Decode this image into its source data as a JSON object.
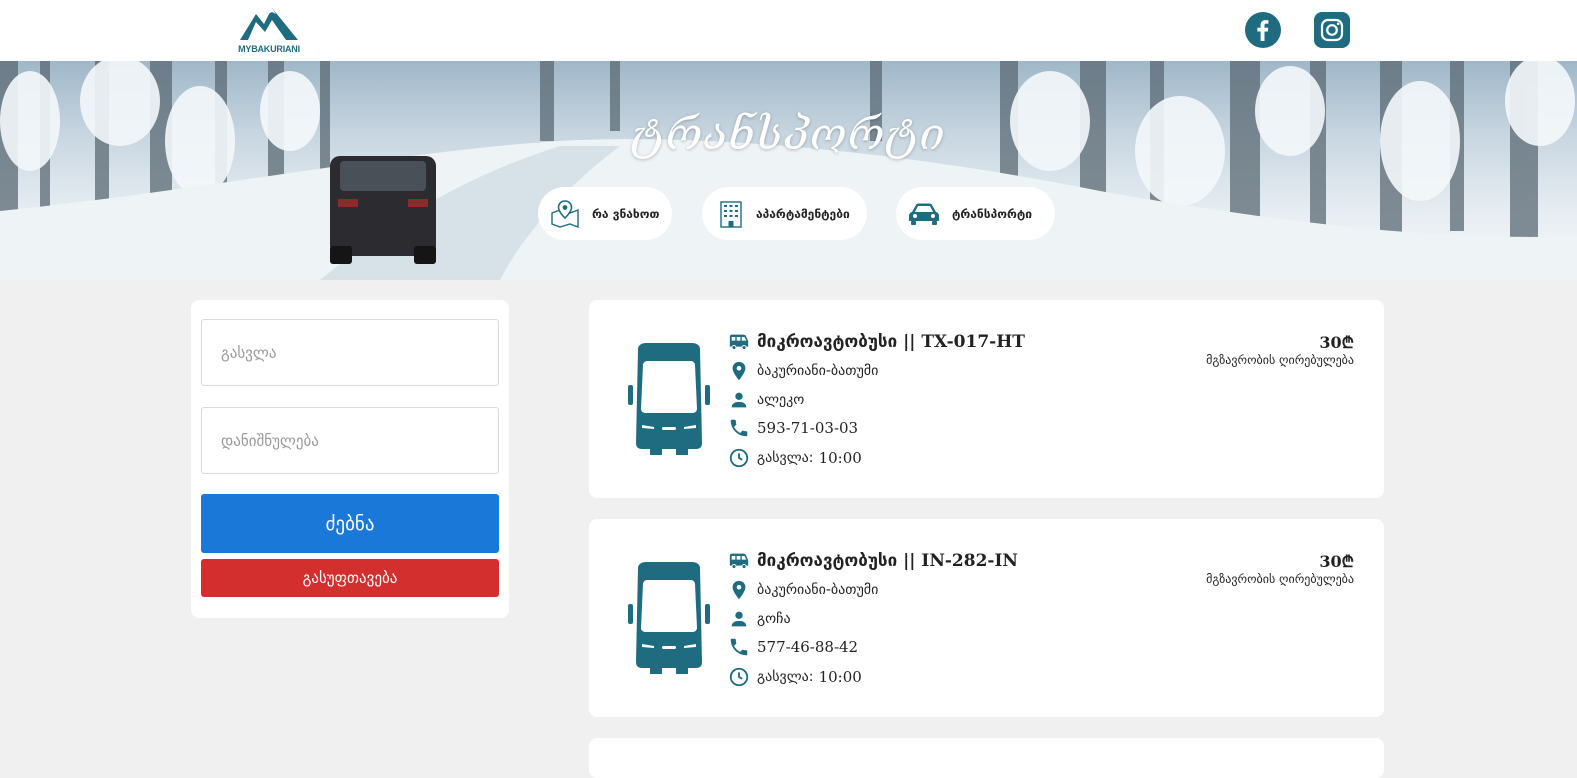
{
  "header": {
    "logo_text": "MYBAKURIANI",
    "social": [
      {
        "name": "facebook-icon"
      },
      {
        "name": "instagram-icon"
      }
    ],
    "brand_color": "#1f6b80"
  },
  "hero": {
    "title": "ტრანსპორტი",
    "nav": [
      {
        "label": "რა ვნახოთ",
        "icon": "map-pin-icon"
      },
      {
        "label": "აპარტამენტები",
        "icon": "building-icon"
      },
      {
        "label": "ტრანსპორტი",
        "icon": "car-icon"
      }
    ]
  },
  "filter": {
    "departure_placeholder": "გასვლა",
    "destination_placeholder": "დანიშნულება",
    "search_label": "ძებნა",
    "clear_label": "გასუფთავება",
    "search_color": "#1a78d8",
    "clear_color": "#d32f2f"
  },
  "listings": [
    {
      "type": "მიკროავტობუსი",
      "separator": " || ",
      "plate": "TX-017-HT",
      "route": "ბაკურიანი-ბათუმი",
      "driver": "ალეკო",
      "phone": "593-71-03-03",
      "departure_label": "გასვლა:",
      "departure_time": "10:00",
      "price": "30₾",
      "price_label": "მგზავრობის ღირებულება"
    },
    {
      "type": "მიკროავტობუსი",
      "separator": " || ",
      "plate": "IN-282-IN",
      "route": "ბაკურიანი-ბათუმი",
      "driver": "გოჩა",
      "phone": "577-46-88-42",
      "departure_label": "გასვლა:",
      "departure_time": "10:00",
      "price": "30₾",
      "price_label": "მგზავრობის ღირებულება"
    }
  ],
  "icon_color": "#1f6b80"
}
